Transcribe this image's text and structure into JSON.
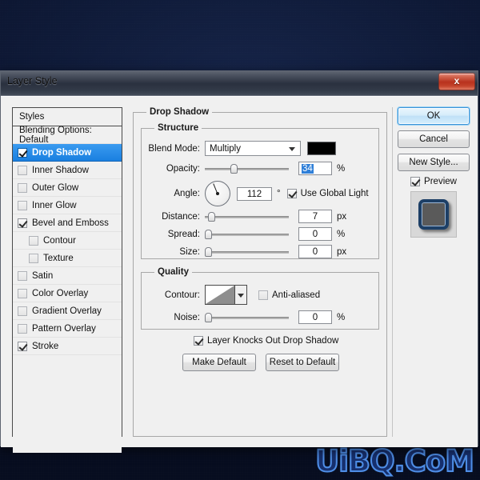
{
  "desktop": {
    "watermark": "UiBQ.CoM",
    "background_color": "#0c1430"
  },
  "window": {
    "title": "Layer Style",
    "close_label": "x"
  },
  "styles_panel": {
    "header": "Styles",
    "items": [
      {
        "label": "Blending Options: Default",
        "checkbox": "none",
        "checked": false,
        "selected": false,
        "indent": false
      },
      {
        "label": "Drop Shadow",
        "checkbox": "checkbox",
        "checked": true,
        "selected": true,
        "indent": false
      },
      {
        "label": "Inner Shadow",
        "checkbox": "checkbox",
        "checked": false,
        "selected": false,
        "indent": false
      },
      {
        "label": "Outer Glow",
        "checkbox": "checkbox",
        "checked": false,
        "selected": false,
        "indent": false
      },
      {
        "label": "Inner Glow",
        "checkbox": "checkbox",
        "checked": false,
        "selected": false,
        "indent": false
      },
      {
        "label": "Bevel and Emboss",
        "checkbox": "checkbox",
        "checked": true,
        "selected": false,
        "indent": false
      },
      {
        "label": "Contour",
        "checkbox": "checkbox",
        "checked": false,
        "selected": false,
        "indent": true
      },
      {
        "label": "Texture",
        "checkbox": "checkbox",
        "checked": false,
        "selected": false,
        "indent": true
      },
      {
        "label": "Satin",
        "checkbox": "checkbox",
        "checked": false,
        "selected": false,
        "indent": false
      },
      {
        "label": "Color Overlay",
        "checkbox": "checkbox",
        "checked": false,
        "selected": false,
        "indent": false
      },
      {
        "label": "Gradient Overlay",
        "checkbox": "checkbox",
        "checked": false,
        "selected": false,
        "indent": false
      },
      {
        "label": "Pattern Overlay",
        "checkbox": "checkbox",
        "checked": false,
        "selected": false,
        "indent": false
      },
      {
        "label": "Stroke",
        "checkbox": "checkbox",
        "checked": true,
        "selected": false,
        "indent": false
      }
    ]
  },
  "main": {
    "group_title": "Drop Shadow",
    "structure": {
      "title": "Structure",
      "blend_mode_label": "Blend Mode:",
      "blend_mode_value": "Multiply",
      "shadow_color": "#000000",
      "opacity_label": "Opacity:",
      "opacity_value": "34",
      "opacity_unit": "%",
      "angle_label": "Angle:",
      "angle_value": "112",
      "angle_unit": "°",
      "use_global_light_label": "Use Global Light",
      "use_global_light_checked": true,
      "distance_label": "Distance:",
      "distance_value": "7",
      "distance_unit": "px",
      "spread_label": "Spread:",
      "spread_value": "0",
      "spread_unit": "%",
      "size_label": "Size:",
      "size_value": "0",
      "size_unit": "px"
    },
    "quality": {
      "title": "Quality",
      "contour_label": "Contour:",
      "anti_aliased_label": "Anti-aliased",
      "anti_aliased_checked": false,
      "noise_label": "Noise:",
      "noise_value": "0",
      "noise_unit": "%"
    },
    "knockout_label": "Layer Knocks Out Drop Shadow",
    "knockout_checked": true,
    "make_default_label": "Make Default",
    "reset_default_label": "Reset to Default"
  },
  "right_panel": {
    "ok_label": "OK",
    "cancel_label": "Cancel",
    "new_style_label": "New Style...",
    "preview_label": "Preview",
    "preview_checked": true
  }
}
